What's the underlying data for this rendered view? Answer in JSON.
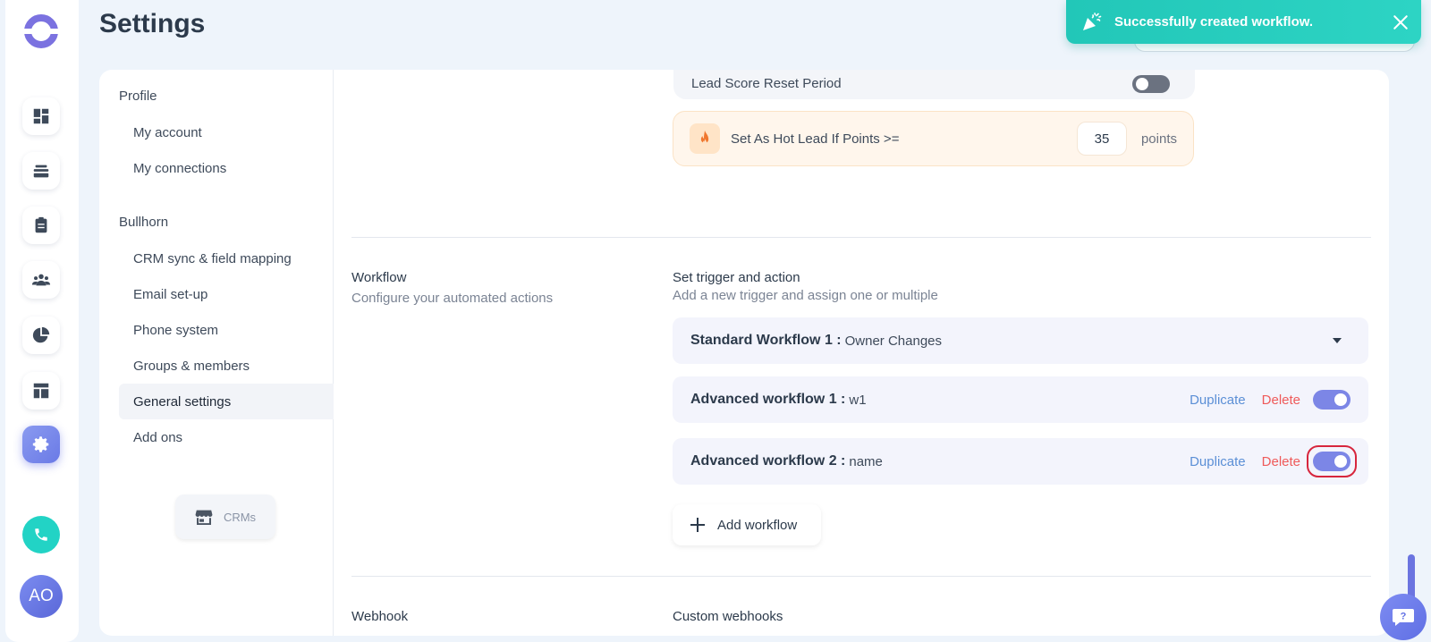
{
  "header": {
    "title": "Settings"
  },
  "toast": {
    "message": "Successfully created workflow."
  },
  "nav": {
    "sections": [
      {
        "label": "Profile",
        "items": [
          "My account",
          "My connections"
        ]
      },
      {
        "label": "Bullhorn",
        "items": [
          "CRM sync & field mapping",
          "Email set-up",
          "Phone system",
          "Groups & members",
          "General settings",
          "Add ons"
        ]
      }
    ],
    "active_item": "General settings",
    "crm_button": "CRMs"
  },
  "lead_score": {
    "reset_label": "Lead Score Reset Period",
    "reset_enabled": false,
    "hot_lead_label": "Set As Hot Lead If Points >=",
    "hot_lead_value": "35",
    "hot_lead_unit": "points"
  },
  "workflow": {
    "title": "Workflow",
    "subtitle": "Configure your automated actions",
    "group_title": "Set trigger and action",
    "group_subtitle": "Add a new trigger and assign one or multiple",
    "standard": {
      "name": "Standard Workflow 1 :",
      "value": "Owner Changes"
    },
    "advanced": [
      {
        "name": "Advanced workflow 1 :",
        "value": "w1",
        "enabled": true
      },
      {
        "name": "Advanced workflow 2 :",
        "value": "name",
        "enabled": true
      }
    ],
    "duplicate_label": "Duplicate",
    "delete_label": "Delete",
    "add_label": "Add workflow"
  },
  "webhook": {
    "title": "Webhook",
    "group_title": "Custom webhooks"
  },
  "user": {
    "initials": "AO"
  },
  "colors": {
    "accent": "#7c86e6",
    "toast": "#2dd4c4",
    "delete": "#ef5a5a",
    "link": "#5b8fd6"
  },
  "icons": {
    "rail": [
      "dashboard-icon",
      "inbox-stack-icon",
      "clipboard-icon",
      "team-icon",
      "pie-chart-icon",
      "layout-icon",
      "gear-icon"
    ],
    "phone": "phone-icon",
    "help": "help-chat-icon",
    "fire": "fire-icon",
    "store": "store-icon",
    "toast": "party-popper-icon",
    "close": "close-icon",
    "plus": "plus-icon"
  }
}
